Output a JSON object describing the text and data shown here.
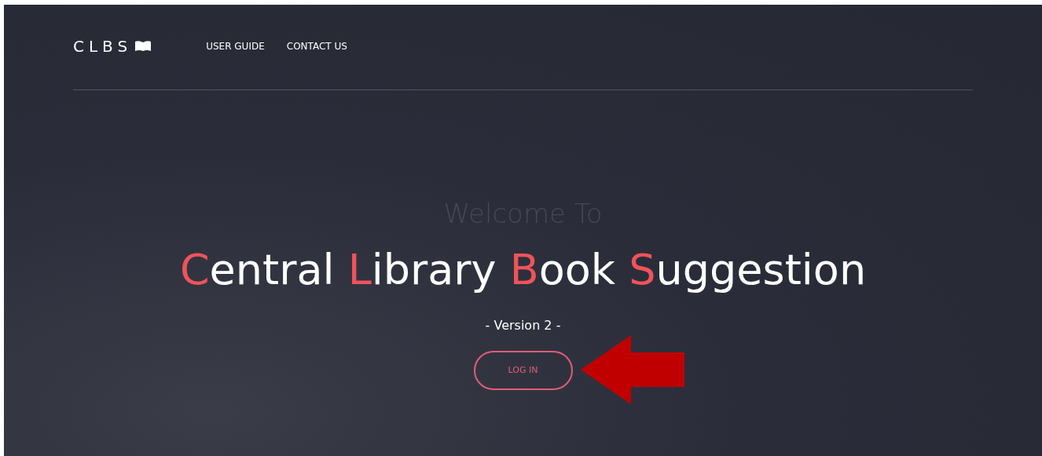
{
  "nav": {
    "logo": "CLBS",
    "links": [
      "USER GUIDE",
      "CONTACT US"
    ]
  },
  "hero": {
    "welcome": "Welcome To",
    "title_words": [
      {
        "initial": "C",
        "rest": "entral"
      },
      {
        "initial": "L",
        "rest": "ibrary"
      },
      {
        "initial": "B",
        "rest": "ook"
      },
      {
        "initial": "S",
        "rest": "uggestion"
      }
    ],
    "version": "- Version 2 -",
    "button": "LOG IN"
  }
}
